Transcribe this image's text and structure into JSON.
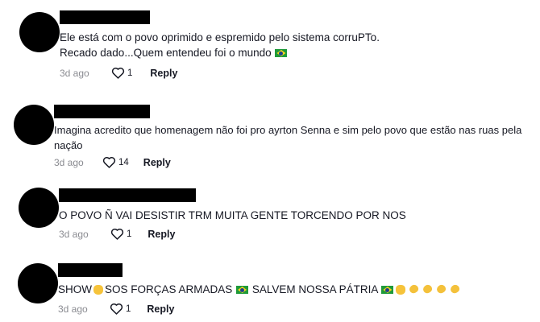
{
  "comments": [
    {
      "lines": [
        "Ele está com o povo oprimido e espremido pelo sistema corruPTo.",
        "Recado dado...Quem entendeu foi o mundo"
      ],
      "date": "3d ago",
      "likes": "1",
      "reply_label": "Reply"
    },
    {
      "lines": [
        "Imagina acredito que homenagem não foi pro ayrton Senna e sim pelo povo que estão nas ruas pela",
        "nação"
      ],
      "date": "3d ago",
      "likes": "14",
      "reply_label": "Reply"
    },
    {
      "lines": [
        "O POVO Ñ VAI DESISTIR TRM MUITA GENTE TORCENDO POR NOS"
      ],
      "date": "3d ago",
      "likes": "1",
      "reply_label": "Reply"
    },
    {
      "text_parts": [
        "SHOW",
        "SOS FORÇAS ARMADAS",
        "SALVEM NOSSA PÁTRIA"
      ],
      "date": "3d ago",
      "likes": "1",
      "reply_label": "Reply"
    }
  ],
  "icons": {
    "like": "heart-outline-icon",
    "flag": "brazil-flag-emoji",
    "hands": "raised-hands-emoji",
    "clap": "clapping-hands-emoji"
  },
  "colors": {
    "text": "#161823",
    "muted": "#8a8b91",
    "redaction": "#000000"
  }
}
